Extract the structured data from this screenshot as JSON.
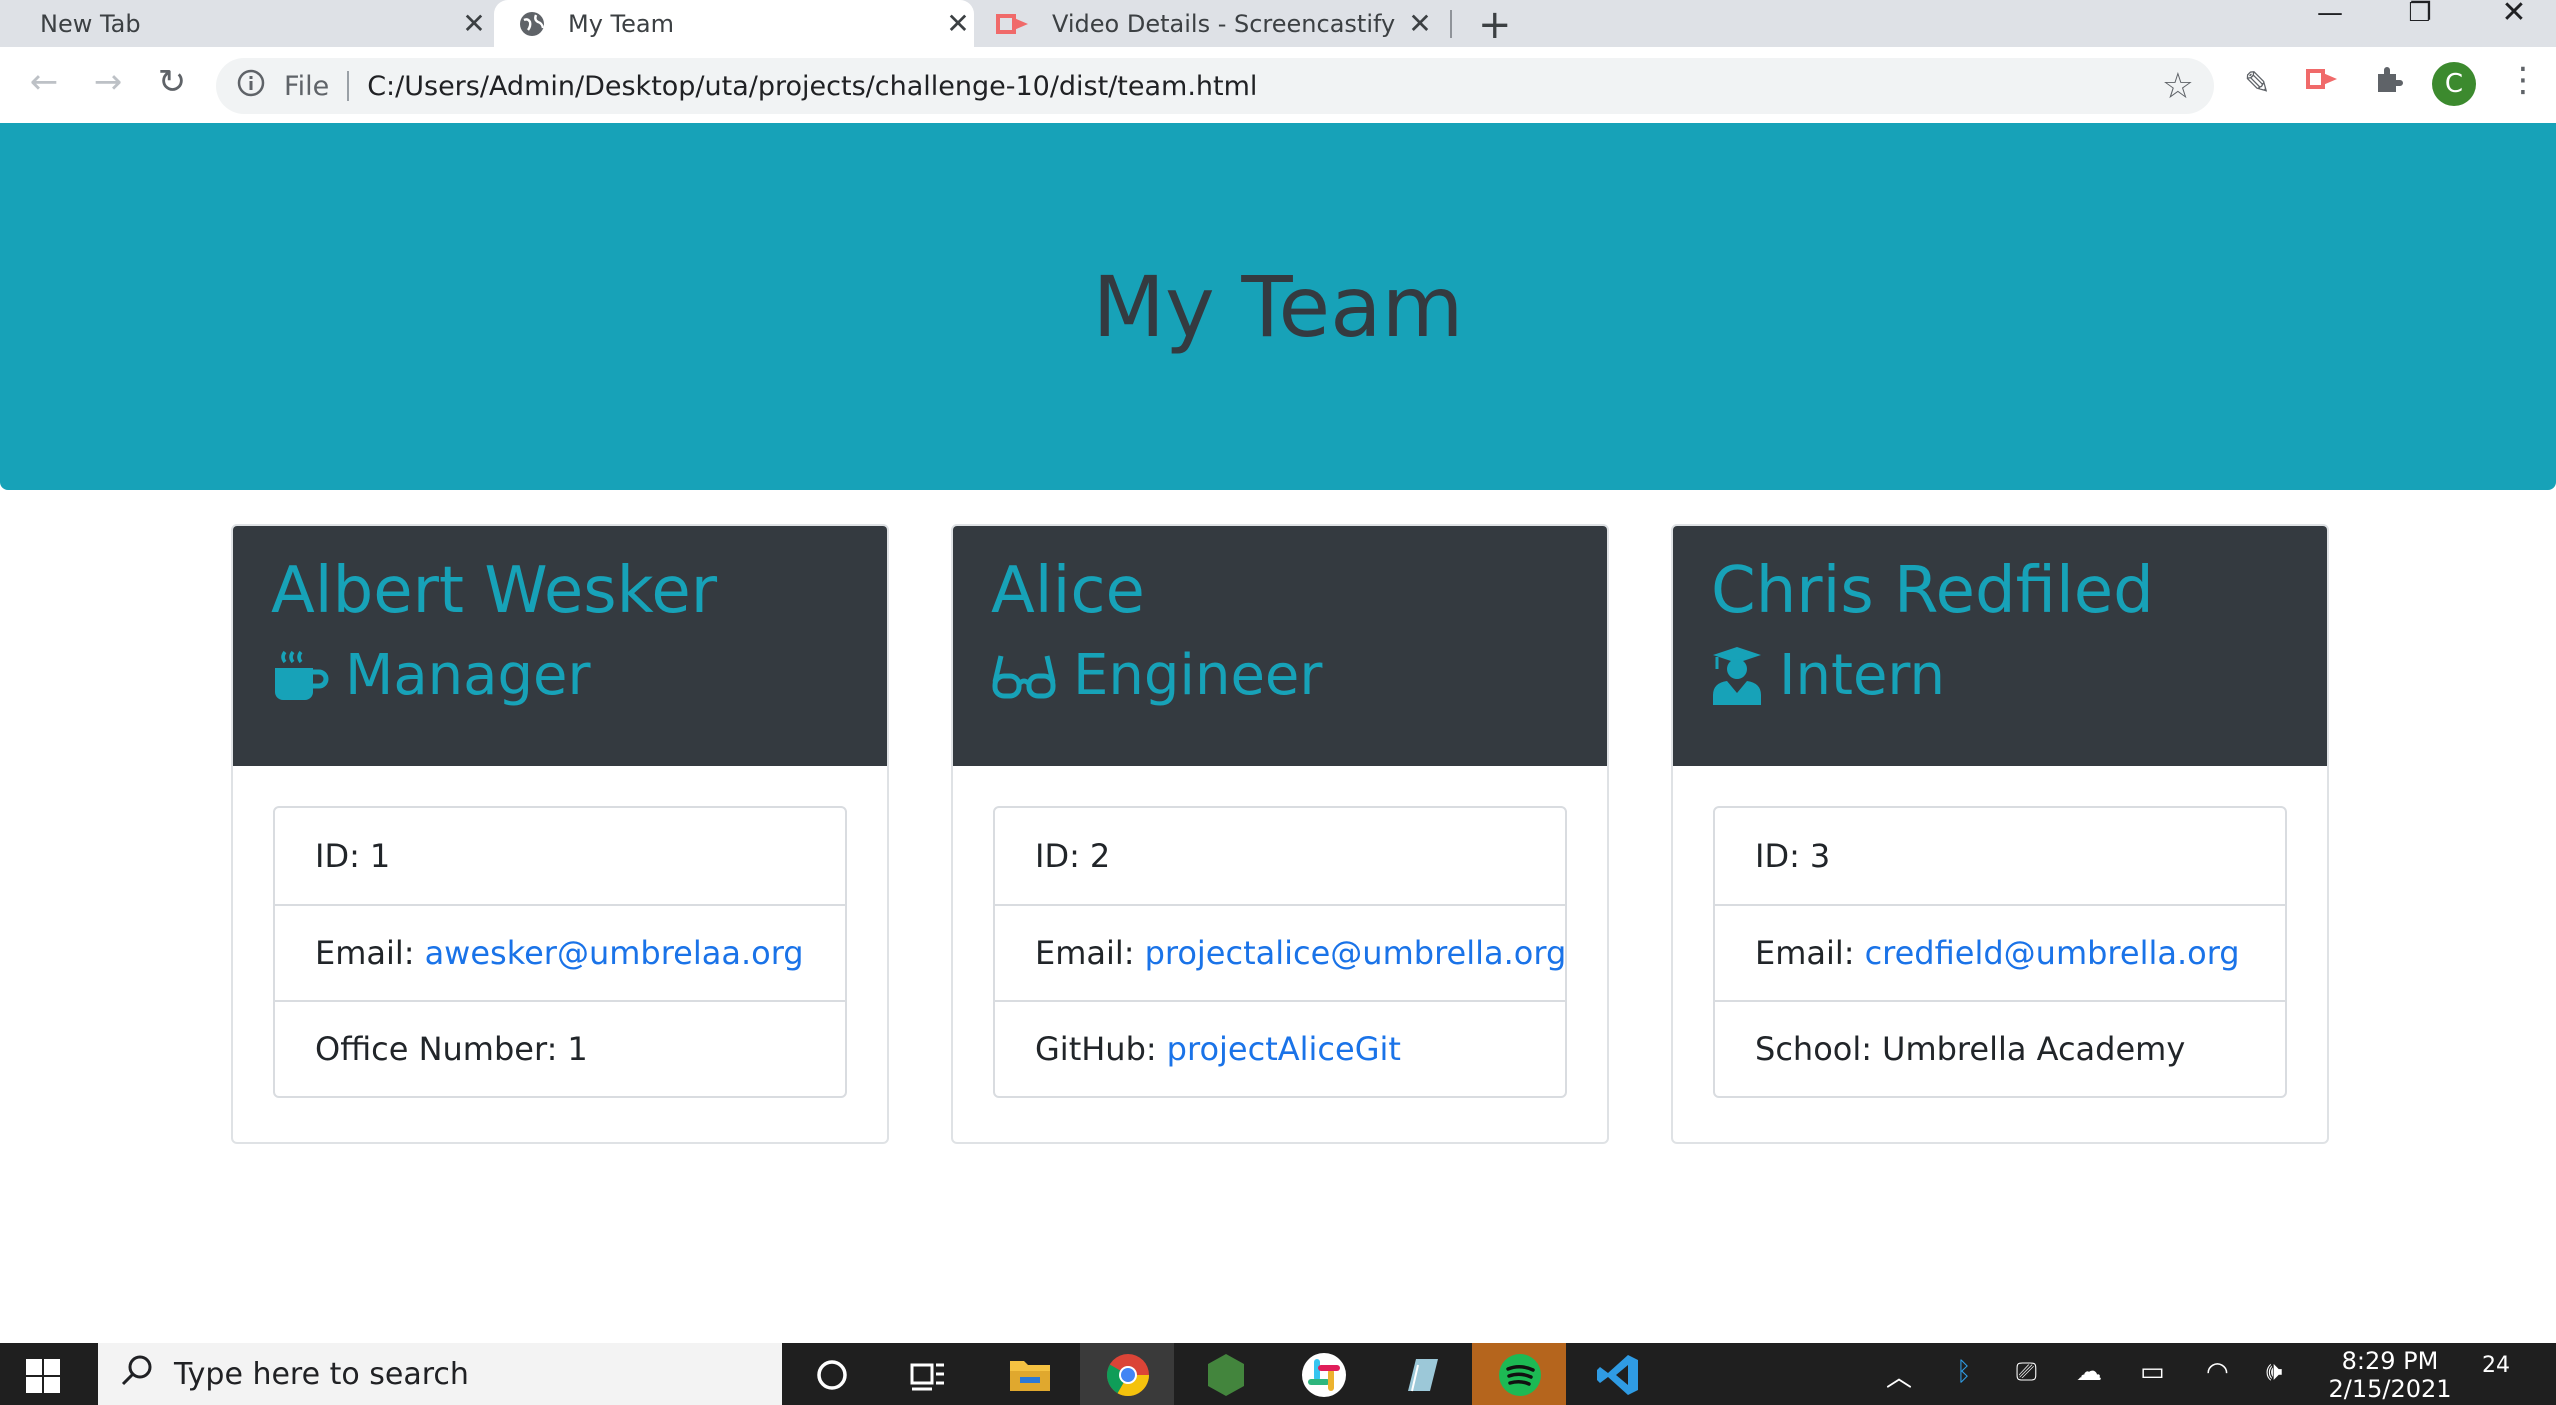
{
  "browser": {
    "tabs": [
      {
        "title": "New Tab",
        "active": false
      },
      {
        "title": "My Team",
        "active": true
      },
      {
        "title": "Video Details - Screencastify",
        "active": false
      }
    ],
    "address": {
      "scheme_label": "File",
      "url": "C:/Users/Admin/Desktop/uta/projects/challenge-10/dist/team.html"
    },
    "profile_initial": "C"
  },
  "page": {
    "heading": "My Team",
    "accent_color": "#17a2b8",
    "header_bg_color": "#343a40",
    "link_color": "#1a73e8",
    "cards": [
      {
        "name": "Albert Wesker",
        "role": "Manager",
        "role_icon": "mug-icon",
        "id_label": "ID:",
        "id_value": "1",
        "email_label": "Email:",
        "email": "awesker@umbrelaa.org",
        "extra_label": "Office Number:",
        "extra_value": "1"
      },
      {
        "name": "Alice",
        "role": "Engineer",
        "role_icon": "glasses-icon",
        "id_label": "ID:",
        "id_value": "2",
        "email_label": "Email:",
        "email": "projectalice@umbrella.org",
        "extra_label": "GitHub:",
        "extra_value": "projectAliceGit"
      },
      {
        "name": "Chris Redfiled",
        "role": "Intern",
        "role_icon": "graduate-icon",
        "id_label": "ID:",
        "id_value": "3",
        "email_label": "Email:",
        "email": "credfield@umbrella.org",
        "extra_label": "School:",
        "extra_value": "Umbrella Academy"
      }
    ]
  },
  "taskbar": {
    "search_placeholder": "Type here to search",
    "time": "8:29 PM",
    "date": "2/15/2021",
    "notification_count": "24"
  }
}
